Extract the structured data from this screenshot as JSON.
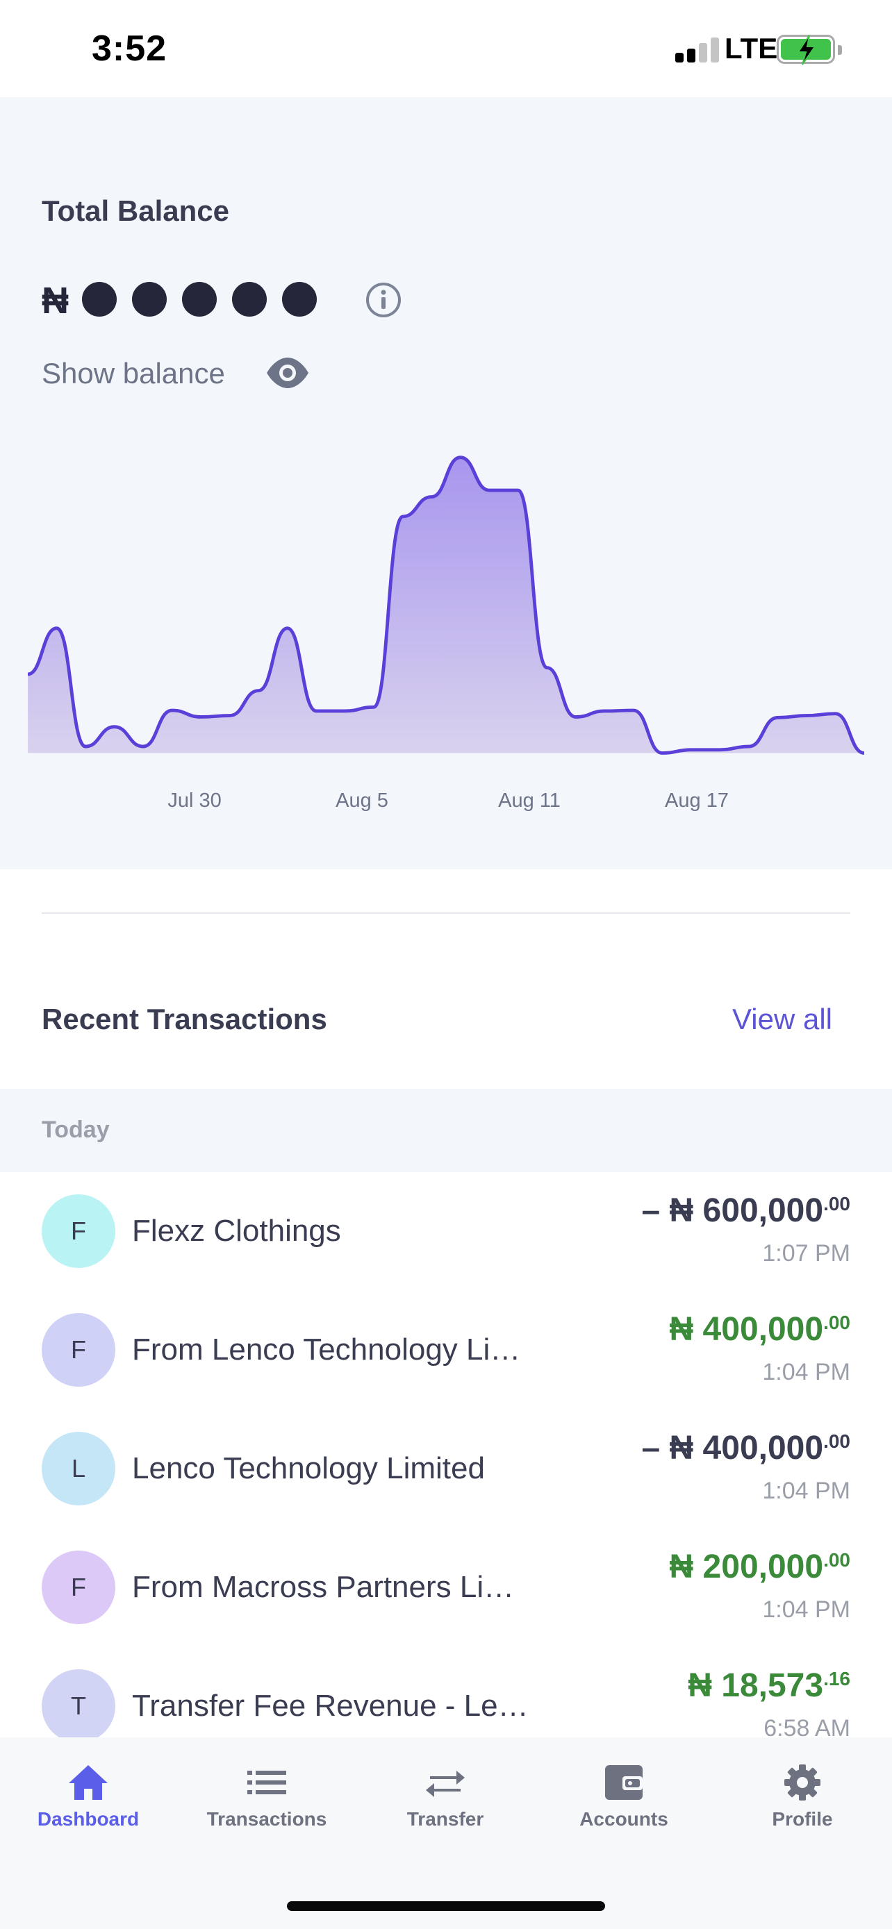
{
  "status_bar": {
    "time": "3:52",
    "network": "LTE"
  },
  "balance": {
    "title": "Total Balance",
    "currency_symbol": "₦",
    "show_balance_label": "Show balance"
  },
  "chart_data": {
    "type": "area",
    "x_tick_labels": [
      "Jul 30",
      "Aug 5",
      "Aug 11",
      "Aug 17"
    ],
    "values": [
      12,
      19,
      1,
      4,
      1,
      6.5,
      5.5,
      5.7,
      9.5,
      19,
      6.4,
      6.4,
      7,
      36,
      39,
      45,
      40,
      40,
      13,
      5.5,
      6.4,
      6.5,
      0,
      0.5,
      0.5,
      1,
      5.4,
      5.7,
      6,
      0
    ],
    "line_color": "#5a3fd8",
    "fill_color": "#b8a8ee",
    "grid": false,
    "legend": "none"
  },
  "recent": {
    "title": "Recent Transactions",
    "view_all": "View all"
  },
  "day_header": "Today",
  "colors": {
    "accent": "#5b55d6",
    "credit": "#3a8a3a",
    "debit": "#3a3d52"
  },
  "transactions": [
    {
      "initial": "F",
      "name": "Flexz Clothings",
      "sign": "– ",
      "symbol": "₦",
      "amount": " 600,000",
      "decimals": ".00",
      "time": "1:07 PM",
      "type": "debit",
      "avatar_color": "#b9f3f3"
    },
    {
      "initial": "F",
      "name": "From Lenco Technology Limited",
      "sign": "",
      "symbol": "₦",
      "amount": " 400,000",
      "decimals": ".00",
      "time": "1:04 PM",
      "type": "credit",
      "avatar_color": "#cfd1f7"
    },
    {
      "initial": "L",
      "name": "Lenco Technology Limited",
      "sign": "– ",
      "symbol": "₦",
      "amount": " 400,000",
      "decimals": ".00",
      "time": "1:04 PM",
      "type": "debit",
      "avatar_color": "#c5e6f7"
    },
    {
      "initial": "F",
      "name": "From Macross Partners Limited",
      "sign": "",
      "symbol": "₦",
      "amount": " 200,000",
      "decimals": ".00",
      "time": "1:04 PM",
      "type": "credit",
      "avatar_color": "#ddc9f7"
    },
    {
      "initial": "T",
      "name": "Transfer Fee Revenue - Lenco",
      "sign": "",
      "symbol": "₦",
      "amount": " 18,573",
      "decimals": ".16",
      "time": "6:58 AM",
      "type": "credit",
      "avatar_color": "#d2d4f5"
    }
  ],
  "tabs": [
    {
      "label": "Dashboard",
      "icon": "home-icon",
      "active": true
    },
    {
      "label": "Transactions",
      "icon": "list-icon",
      "active": false
    },
    {
      "label": "Transfer",
      "icon": "transfer-arrows-icon",
      "active": false
    },
    {
      "label": "Accounts",
      "icon": "wallet-icon",
      "active": false
    },
    {
      "label": "Profile",
      "icon": "gear-icon",
      "active": false
    }
  ]
}
